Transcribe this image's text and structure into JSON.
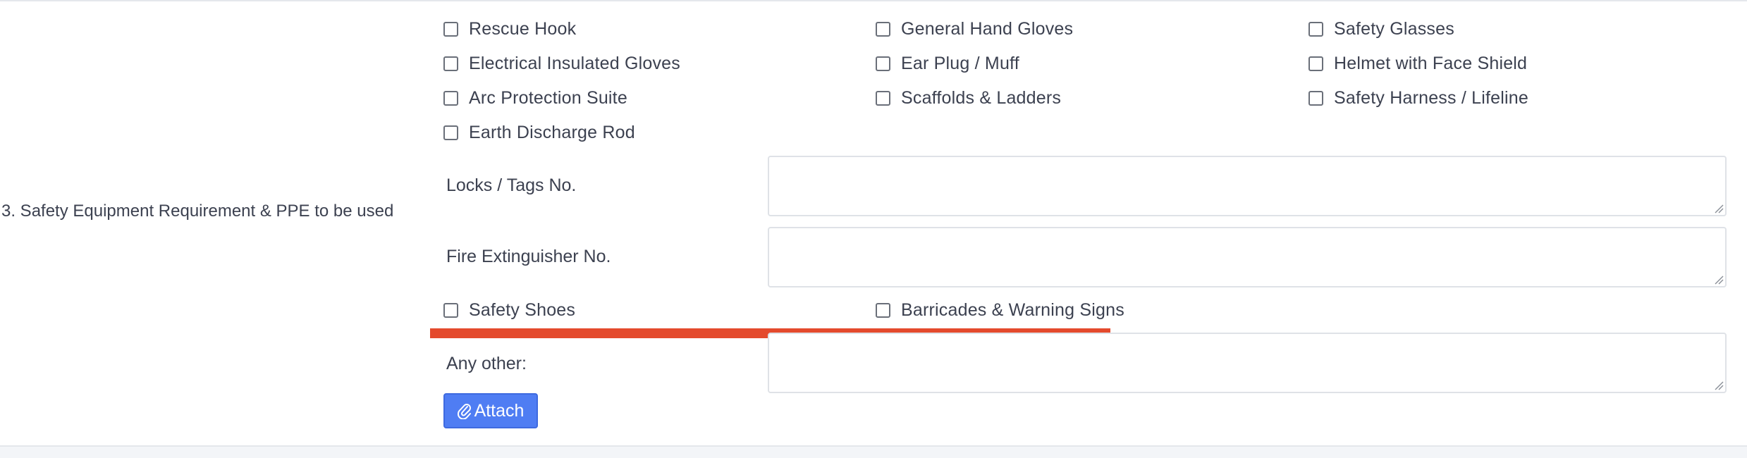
{
  "section": {
    "title": "3. Safety Equipment Requirement & PPE to be used"
  },
  "ppe_checkboxes": [
    {
      "label": "Rescue Hook",
      "checked": false
    },
    {
      "label": "General Hand Gloves",
      "checked": false
    },
    {
      "label": "Safety Glasses",
      "checked": false
    },
    {
      "label": "Electrical Insulated Gloves",
      "checked": false
    },
    {
      "label": "Ear Plug / Muff",
      "checked": false
    },
    {
      "label": "Helmet with Face Shield",
      "checked": false
    },
    {
      "label": "Arc Protection Suite",
      "checked": false
    },
    {
      "label": "Scaffolds & Ladders",
      "checked": false
    },
    {
      "label": "Safety Harness / Lifeline",
      "checked": false
    },
    {
      "label": "Earth Discharge Rod",
      "checked": false
    }
  ],
  "fields": {
    "locks_tags": {
      "label": "Locks / Tags No.",
      "value": ""
    },
    "fire_extinguisher": {
      "label": "Fire Extinguisher No.",
      "value": ""
    },
    "any_other": {
      "label": "Any other:",
      "value": ""
    }
  },
  "extra_checkboxes": [
    {
      "label": "Safety Shoes",
      "checked": false
    },
    {
      "label": "Barricades & Warning Signs",
      "checked": false
    }
  ],
  "attach_button": {
    "label": "Attach",
    "icon": "paperclip-icon"
  },
  "colors": {
    "annotation_underline": "#e44a2d",
    "button": "#4f7df3",
    "text": "#3c4150"
  }
}
